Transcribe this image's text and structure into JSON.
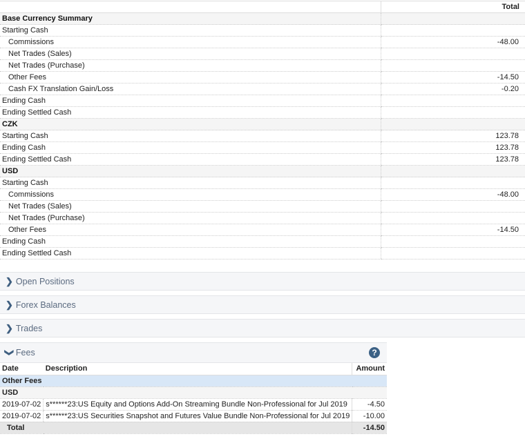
{
  "summary": {
    "column_header": "Total",
    "rows": [
      {
        "label": "Base Currency Summary",
        "type": "section",
        "value": ""
      },
      {
        "label": "Starting Cash",
        "type": "row",
        "value": ""
      },
      {
        "label": "Commissions",
        "type": "indent",
        "value": "-48.00"
      },
      {
        "label": "Net Trades (Sales)",
        "type": "indent",
        "value": ""
      },
      {
        "label": "Net Trades (Purchase)",
        "type": "indent",
        "value": ""
      },
      {
        "label": "Other Fees",
        "type": "indent",
        "value": "-14.50"
      },
      {
        "label": "Cash FX Translation Gain/Loss",
        "type": "indent",
        "value": "-0.20"
      },
      {
        "label": "Ending Cash",
        "type": "row",
        "value": ""
      },
      {
        "label": "Ending Settled Cash",
        "type": "row",
        "value": ""
      },
      {
        "label": "CZK",
        "type": "section",
        "value": ""
      },
      {
        "label": "Starting Cash",
        "type": "row",
        "value": "123.78"
      },
      {
        "label": "Ending Cash",
        "type": "row",
        "value": "123.78"
      },
      {
        "label": "Ending Settled Cash",
        "type": "row",
        "value": "123.78"
      },
      {
        "label": "USD",
        "type": "section",
        "value": ""
      },
      {
        "label": "Starting Cash",
        "type": "row",
        "value": ""
      },
      {
        "label": "Commissions",
        "type": "indent",
        "value": "-48.00"
      },
      {
        "label": "Net Trades (Sales)",
        "type": "indent",
        "value": ""
      },
      {
        "label": "Net Trades (Purchase)",
        "type": "indent",
        "value": ""
      },
      {
        "label": "Other Fees",
        "type": "indent",
        "value": "-14.50"
      },
      {
        "label": "Ending Cash",
        "type": "row",
        "value": ""
      },
      {
        "label": "Ending Settled Cash",
        "type": "row",
        "value": ""
      }
    ]
  },
  "panels": {
    "open_positions": "Open Positions",
    "forex_balances": "Forex Balances",
    "trades": "Trades",
    "fees": "Fees"
  },
  "fees": {
    "headers": {
      "date": "Date",
      "description": "Description",
      "amount": "Amount"
    },
    "category": "Other Fees",
    "currency": "USD",
    "rows": [
      {
        "date": "2019-07-02",
        "description": "s******23:US Equity and Options Add-On Streaming Bundle Non-Professional for Jul 2019",
        "amount": "-4.50"
      },
      {
        "date": "2019-07-02",
        "description": "s******23:US Securities Snapshot and Futures Value Bundle Non-Professional for Jul 2019",
        "amount": "-10.00"
      }
    ],
    "total_label": "Total",
    "total": "-14.50"
  }
}
